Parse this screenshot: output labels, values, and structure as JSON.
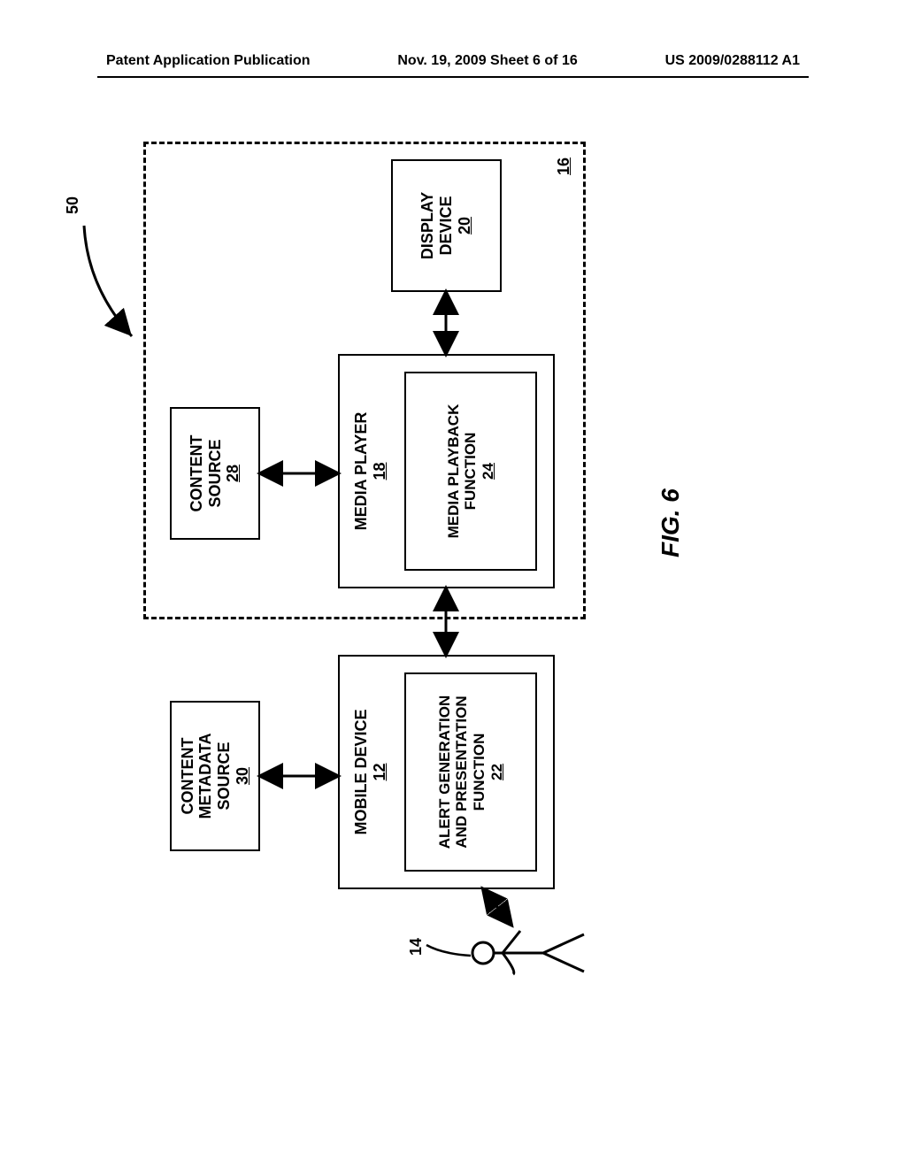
{
  "header": {
    "left": "Patent Application Publication",
    "center": "Nov. 19, 2009  Sheet 6 of 16",
    "right": "US 2009/0288112 A1"
  },
  "fig_label": "FIG. 6",
  "labels": {
    "system_ref": "50",
    "user_ref": "14",
    "env_ref": "16"
  },
  "boxes": {
    "content_metadata_source": {
      "title": "CONTENT\nMETADATA\nSOURCE",
      "ref": "30"
    },
    "content_source": {
      "title": "CONTENT\nSOURCE",
      "ref": "28"
    },
    "mobile_device": {
      "title": "MOBILE DEVICE",
      "ref": "12"
    },
    "alert_function": {
      "title": "ALERT GENERATION\nAND PRESENTATION\nFUNCTION",
      "ref": "22"
    },
    "media_player": {
      "title": "MEDIA PLAYER",
      "ref": "18"
    },
    "media_playback": {
      "title": "MEDIA PLAYBACK\nFUNCTION",
      "ref": "24"
    },
    "display_device": {
      "title": "DISPLAY\nDEVICE",
      "ref": "20"
    }
  }
}
